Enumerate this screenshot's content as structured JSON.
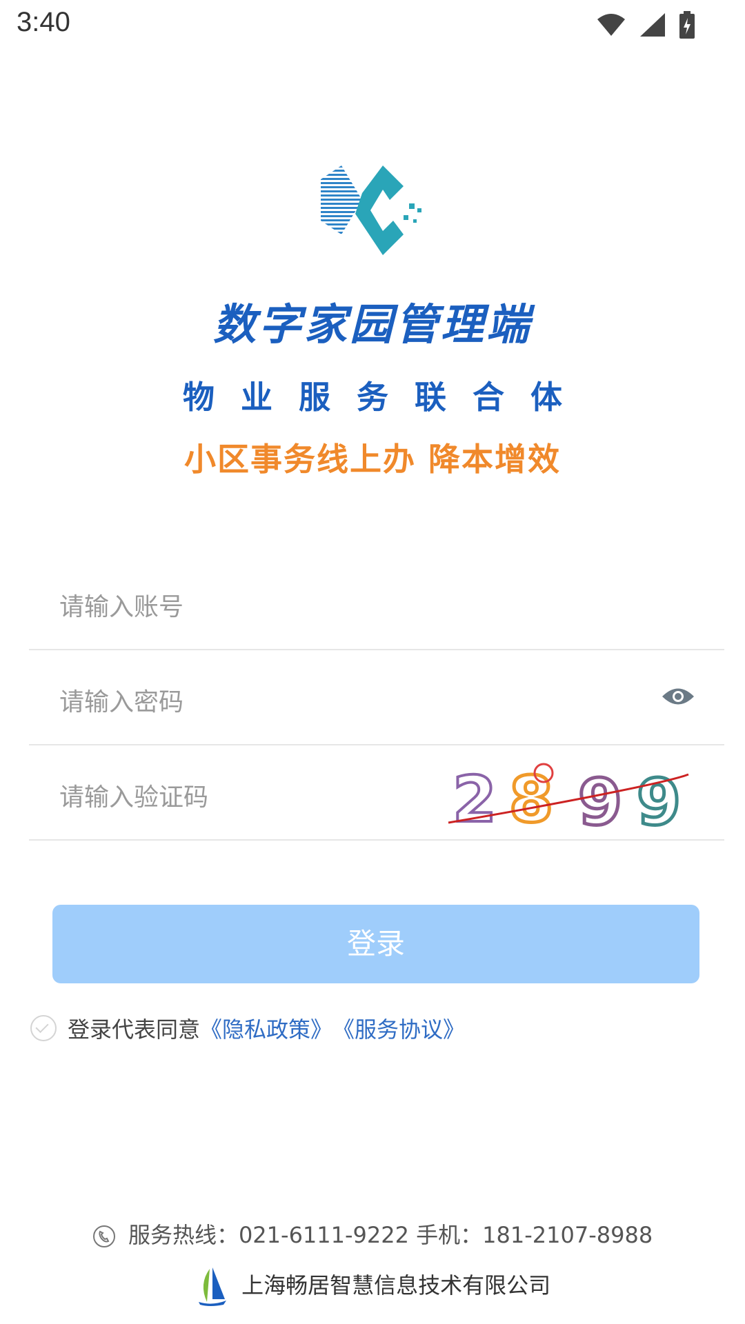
{
  "status": {
    "time": "3:40"
  },
  "brand": {
    "title": "数字家园管理端",
    "tagline": "物业服务联合体",
    "slogan": "小区事务线上办 降本增效",
    "colors": {
      "primary": "#1b5fbf",
      "accent": "#f0892b",
      "teal": "#2aa5b8"
    }
  },
  "form": {
    "account_placeholder": "请输入账号",
    "password_placeholder": "请输入密码",
    "captcha_placeholder": "请输入验证码",
    "captcha_text": "2899"
  },
  "login_button": "登录",
  "agreement": {
    "prefix": "登录代表同意",
    "privacy": "《隐私政策》",
    "service": "《服务协议》"
  },
  "footer": {
    "hotline": "服务热线：021-6111-9222 手机：181-2107-8988",
    "company": "上海畅居智慧信息技术有限公司"
  },
  "icons": [
    "wifi-icon",
    "signal-icon",
    "battery-icon",
    "eye-icon",
    "phone-icon",
    "company-logo-icon",
    "check-circle-icon"
  ]
}
